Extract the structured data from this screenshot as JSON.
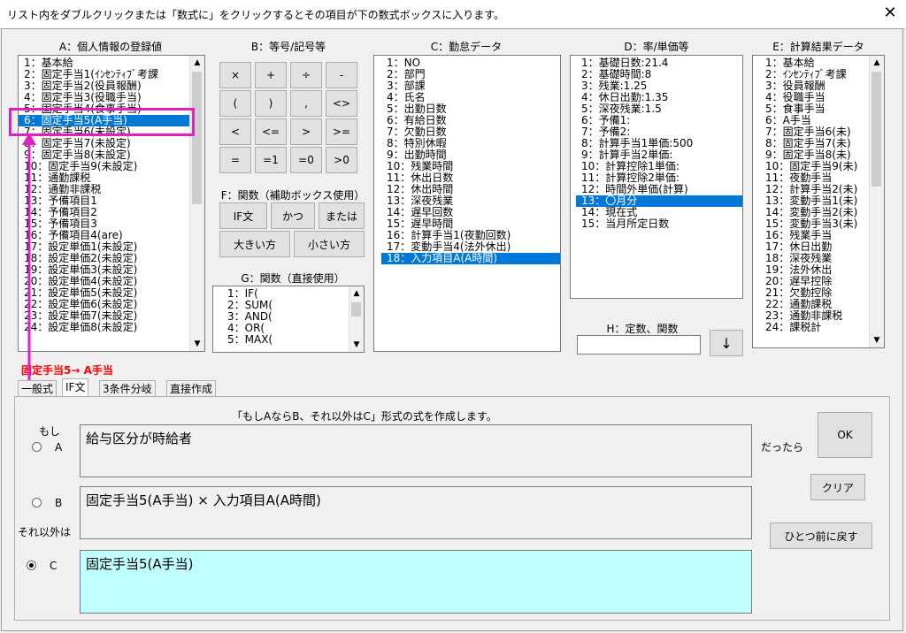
{
  "window": {
    "title": "リスト内をダブルクリックまたは「数式に」をクリックするとその項目が下の数式ボックスに入ります。",
    "close_label": "✕"
  },
  "sections": {
    "a_header": "A：個人情報の登録値",
    "b_header": "B：等号/記号等",
    "c_header": "C：勤怠データ",
    "d_header": "D：率/単価等",
    "e_header": "E：計算結果データ",
    "f_header": "F：関数（補助ボックス使用）",
    "g_header": "G：関数（直接使用）",
    "h_header": "H：定数、関数"
  },
  "list_a": {
    "items": [
      "1：基本給",
      "2：固定手当1(ｲﾝｾﾝﾃｨﾌﾞ考課",
      "3：固定手当2(役員報酬)",
      "4：固定手当3(役職手当)",
      "5：固定手当4(食事手当)",
      "6：固定手当5(A手当)",
      "7：固定手当6(未設定)",
      "8：固定手当7(未設定)",
      "9：固定手当8(未設定)",
      "10：固定手当9(未設定)",
      "11：通勤課税",
      "12：通勤非課税",
      "13：予備項目1",
      "14：予備項目2",
      "15：予備項目3",
      "16：予備項目4(are)",
      "17：設定単価1(未設定)",
      "18：設定単価2(未設定)",
      "19：設定単価3(未設定)",
      "20：設定単価4(未設定)",
      "21：設定単価5(未設定)",
      "22：設定単価6(未設定)",
      "23：設定単価7(未設定)",
      "24：設定単価8(未設定)"
    ],
    "selected_index": 5,
    "selected_label": "6：固定手当5(A手当)"
  },
  "symbols": [
    "×",
    "+",
    "÷",
    "-",
    "(",
    ")",
    ",",
    "<>",
    "<",
    "<=",
    ">",
    ">=",
    "=",
    "=1",
    "=0",
    ">0"
  ],
  "func_f": {
    "if": "IF文",
    "and": "かつ",
    "or": "または",
    "max": "大きい方",
    "min": "小さい方"
  },
  "list_g": {
    "items": [
      "1：IF(",
      "2：SUM(",
      "3：AND(",
      "4：OR(",
      "5：MAX("
    ]
  },
  "list_c": {
    "items": [
      "1：NO",
      "2：部門",
      "3：部課",
      "4：氏名",
      "5：出勤日数",
      "6：有給日数",
      "7：欠勤日数",
      "8：特別休暇",
      "9：出勤時間",
      "10：残業時間",
      "11：休出日数",
      "12：休出時間",
      "13：深夜残業",
      "14：遅早回数",
      "15：遅早時間",
      "16：計算手当1(夜勤回数)",
      "17：変動手当4(法外休出)",
      "18：入力項目A(A時間)"
    ],
    "selected_index": 17
  },
  "list_d": {
    "items": [
      "1：基礎日数:21.4",
      "2：基礎時間:8",
      "3：残業:1.25",
      "4：休日出勤:1.35",
      "5：深夜残業:1.5",
      "6：予備1:",
      "7：予備2:",
      "8：計算手当1単価:500",
      "9：計算手当2単価:",
      "10：計算控除1単価:",
      "11：計算控除2単価:",
      "12：時間外単価(計算)",
      "13：〇月分",
      "14：現在式",
      "15：当月所定日数"
    ],
    "selected_index": 12
  },
  "list_e": {
    "items": [
      "1：基本給",
      "2：ｲﾝｾﾝﾃｨﾌﾞ考課",
      "3：役員報酬",
      "4：役職手当",
      "5：食事手当",
      "6：A手当",
      "7：固定手当6(未)",
      "8：固定手当7(未)",
      "9：固定手当8(未)",
      "10：固定手当9(未)",
      "11：夜勤手当",
      "12：計算手当2(未)",
      "13：変動手当1(未)",
      "14：変動手当2(未)",
      "15：変動手当3(未)",
      "16：残業手当",
      "17：休日出勤",
      "18：深夜残業",
      "19：法外休出",
      "20：遅早控除",
      "21：欠勤控除",
      "22：通勤課税",
      "23：通勤非課税",
      "24：課税計"
    ]
  },
  "h": {
    "input_value": "",
    "down_label": "↓"
  },
  "annotation": {
    "text": "固定手当5→ A手当",
    "color": "#ff0000",
    "highlight_color": "#e020c0"
  },
  "tabs": [
    {
      "label": "一般式"
    },
    {
      "label": "IF文"
    },
    {
      "label": "3条件分岐"
    },
    {
      "label": "直接作成"
    }
  ],
  "if_panel": {
    "description": "「もしAならB、それ以外はC」形式の式を作成します。",
    "if_label": "もし",
    "else_label": "それ以外は",
    "then_label": "だったら",
    "radio_a": "A",
    "radio_b": "B",
    "radio_c": "C",
    "expr_a": "給与区分が時給者",
    "expr_b": "固定手当5(A手当) × 入力項目A(A時間)",
    "expr_c": "固定手当5(A手当)",
    "selected_radio": "C",
    "expr_c_bg": "#c0ffff",
    "ok_label": "OK",
    "clear_label": "クリア",
    "back_label": "ひとつ前に戻す"
  }
}
